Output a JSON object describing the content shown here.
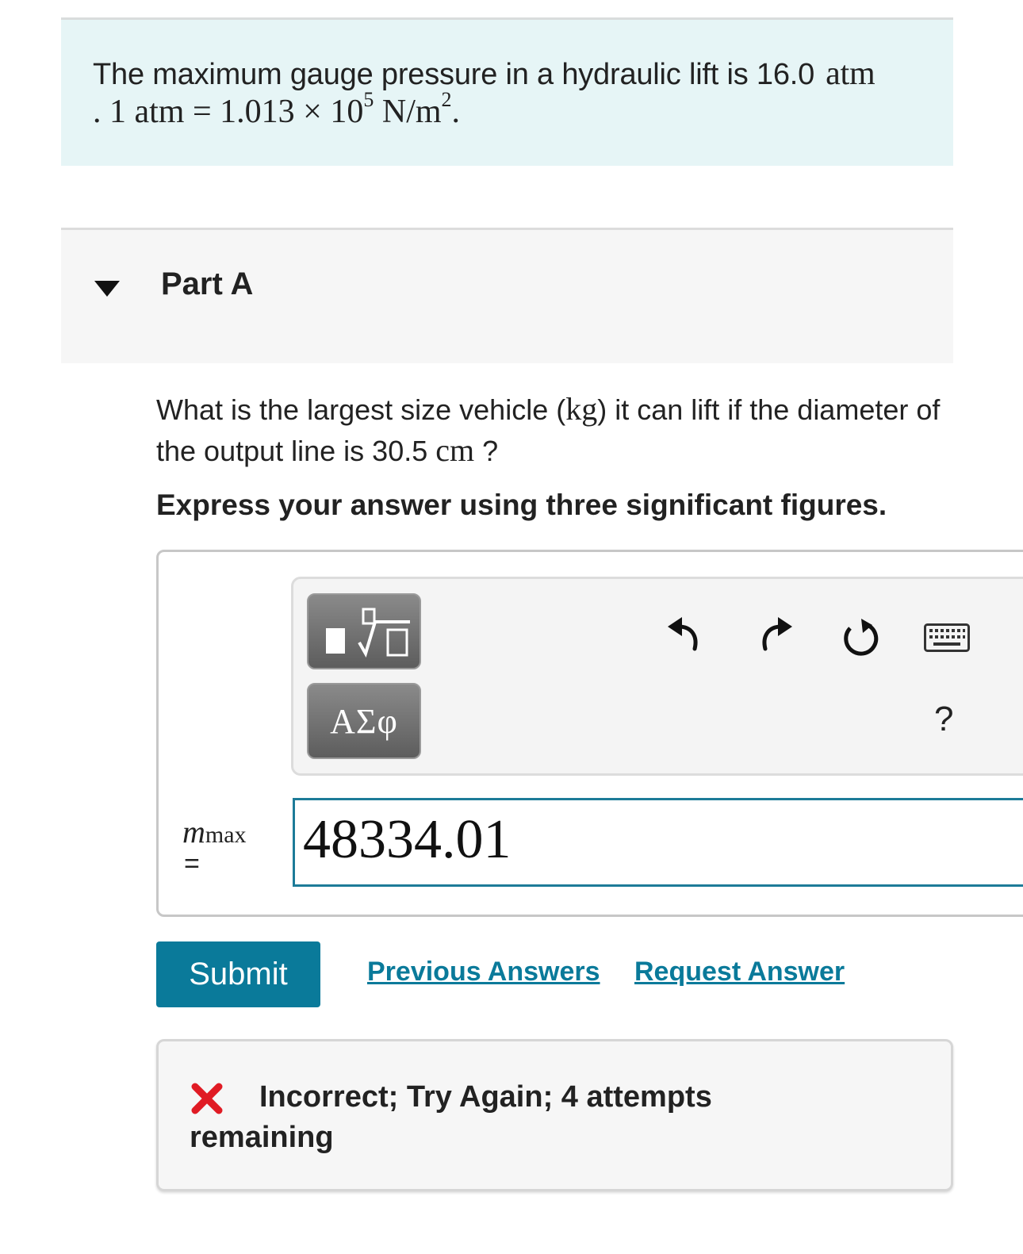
{
  "intro": {
    "line1_text": "The maximum gauge pressure in a hydraulic lift is 16.0",
    "line1_unit": "atm",
    "line2_prefix": ". 1 atm = 1.013 × 10",
    "line2_exp": "5",
    "line2_unit": " N/m",
    "line2_unit_exp": "2",
    "line2_end": "."
  },
  "part": {
    "title": "Part A",
    "toggle_icon": "caret-down-icon"
  },
  "question": {
    "text_a": "What is the largest size vehicle (",
    "unit_a": "kg",
    "text_b": ") it can lift if the diameter of the output line is 30.5",
    "unit_b": "cm",
    "text_c": "?",
    "instructions": "Express your answer using three significant figures."
  },
  "toolbar": {
    "templates_icon": "templates-icon",
    "symbols_label": "ΑΣφ",
    "undo_icon": "undo-icon",
    "redo_icon": "redo-icon",
    "reset_icon": "reset-icon",
    "keyboard_icon": "keyboard-icon",
    "help_label": "?"
  },
  "answer": {
    "var_symbol": "m",
    "var_sub": "max",
    "equals": "=",
    "value": "48334.01"
  },
  "actions": {
    "submit_label": "Submit",
    "previous_answers_label": "Previous Answers",
    "request_answer_label": "Request Answer"
  },
  "feedback": {
    "icon": "x-mark-icon",
    "text": "Incorrect; Try Again; 4 attempts remaining"
  },
  "colors": {
    "intro_bg": "#e6f5f6",
    "accent": "#0a7a9a",
    "error": "#e01b24"
  }
}
